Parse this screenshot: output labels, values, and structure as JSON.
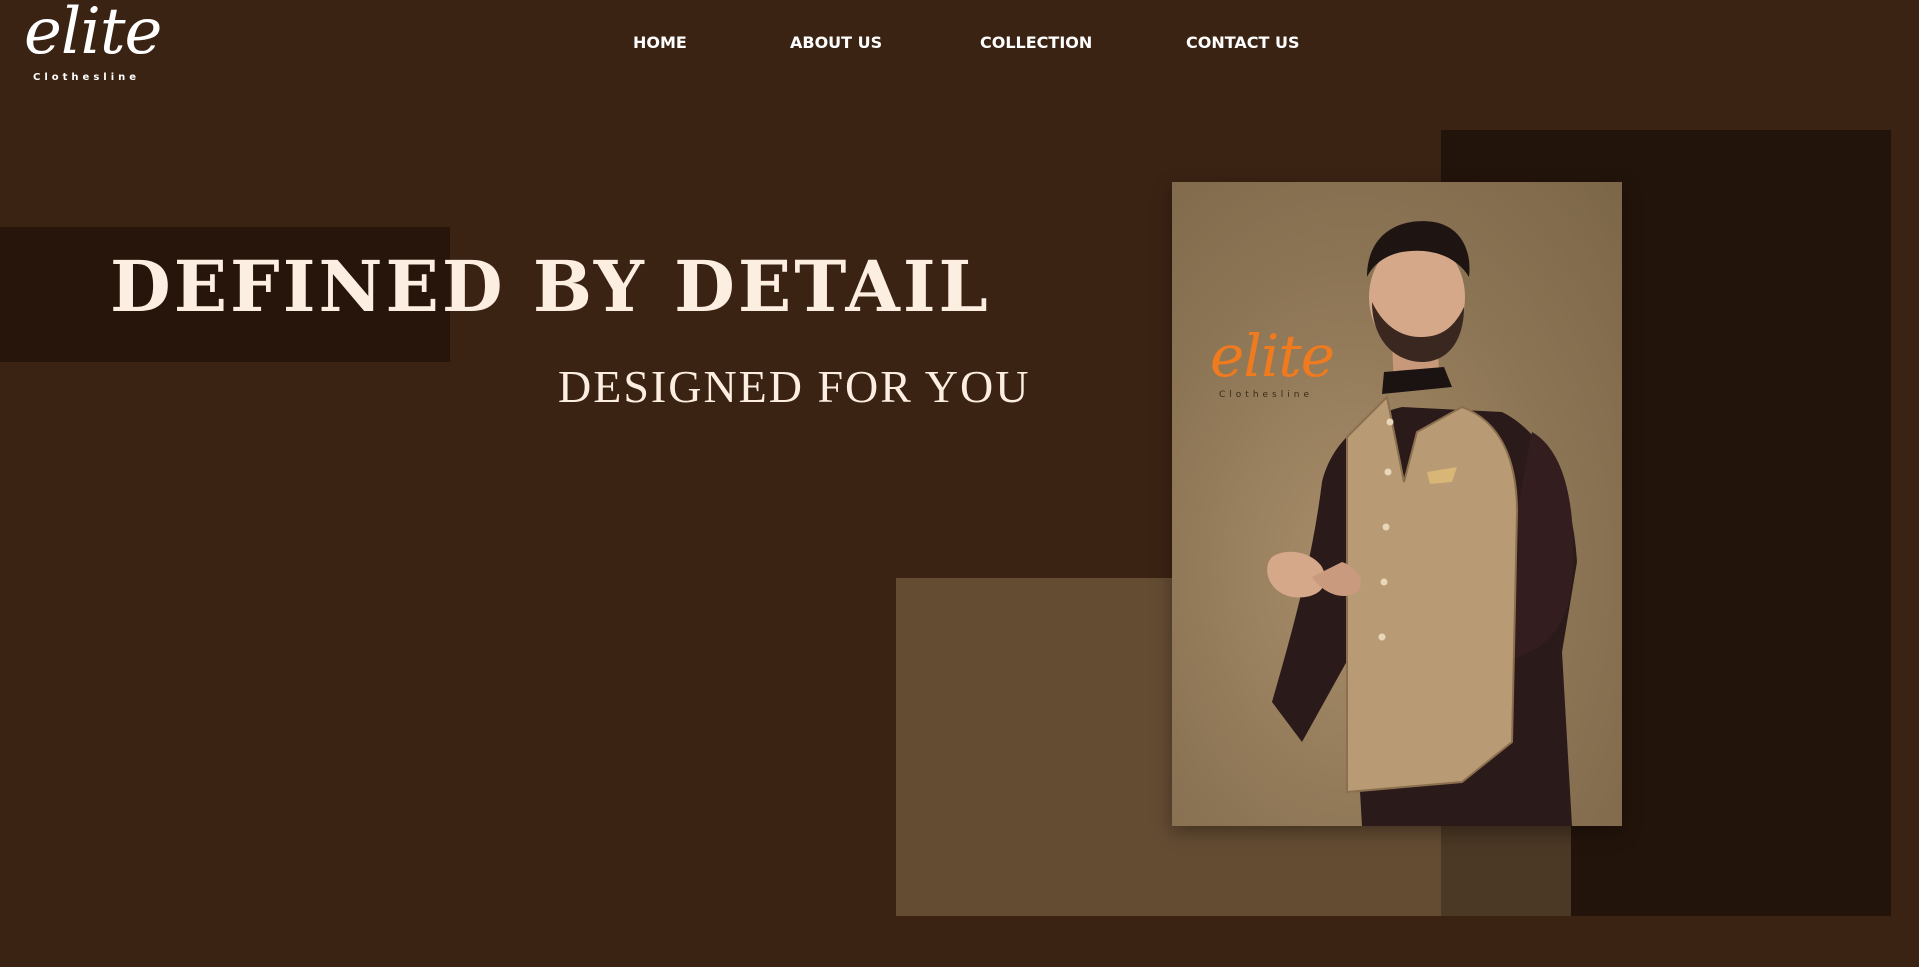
{
  "brand": {
    "name": "elite",
    "tagline": "Clothesline"
  },
  "nav": {
    "items": [
      {
        "label": "HOME"
      },
      {
        "label": "ABOUT US"
      },
      {
        "label": "COLLECTION"
      },
      {
        "label": "CONTACT US"
      }
    ]
  },
  "hero": {
    "headline": "DEFINED BY DETAIL",
    "subheadline": "DESIGNED FOR YOU"
  },
  "photo": {
    "brand_name": "elite",
    "brand_tagline": "Clothesline"
  },
  "colors": {
    "background": "#3b2314",
    "accent_dark": "#27150b",
    "accent_tan": "#644c33",
    "text_light": "#fdeee2",
    "logo_orange": "#f07a1e"
  }
}
